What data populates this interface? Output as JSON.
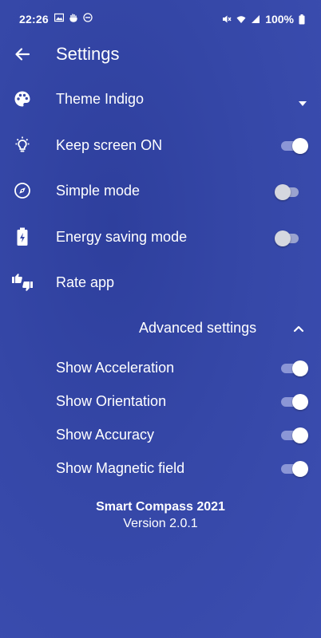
{
  "status_bar": {
    "time": "22:26",
    "battery": "100%"
  },
  "app_bar": {
    "title": "Settings"
  },
  "settings": {
    "theme_label": "Theme Indigo",
    "keep_screen_label": "Keep screen ON",
    "keep_screen_on": true,
    "simple_mode_label": "Simple mode",
    "simple_mode_on": false,
    "energy_label": "Energy saving mode",
    "energy_on": false,
    "rate_label": "Rate app"
  },
  "advanced": {
    "title": "Advanced settings",
    "expanded": true,
    "items": [
      {
        "label": "Show Acceleration",
        "on": true
      },
      {
        "label": "Show Orientation",
        "on": true
      },
      {
        "label": "Show Accuracy",
        "on": true
      },
      {
        "label": "Show Magnetic field",
        "on": true
      }
    ]
  },
  "footer": {
    "app_name": "Smart Compass 2021",
    "version": "Version 2.0.1"
  },
  "colors": {
    "background": "#3547a7",
    "switch_on_track": "#8b96d6",
    "switch_off_knob": "#d5d7df"
  },
  "icons": [
    "image-icon",
    "hand-icon",
    "do-not-disturb-icon",
    "mute-icon",
    "wifi-icon",
    "signal-icon",
    "battery-icon",
    "back-arrow-icon",
    "palette-icon",
    "lightbulb-icon",
    "compass-icon",
    "battery-charging-icon",
    "thumbs-icon",
    "dropdown-arrow-icon",
    "chevron-up-icon"
  ]
}
